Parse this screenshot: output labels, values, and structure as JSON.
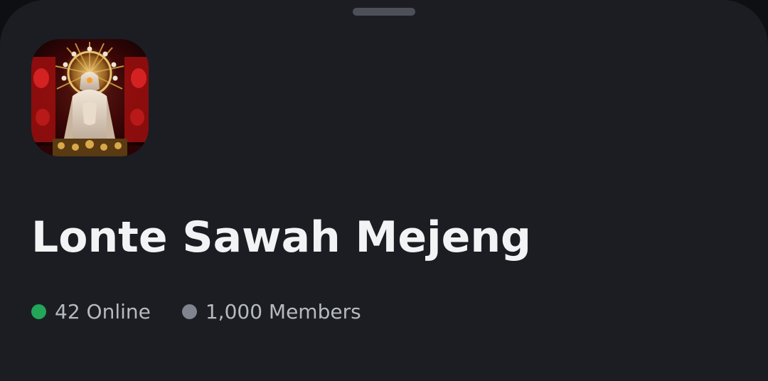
{
  "server": {
    "name": "Lonte Sawah Mejeng",
    "icon": "server-icon-image",
    "online_label": "42 Online",
    "members_label": "1,000 Members"
  },
  "colors": {
    "background": "#1c1d22",
    "online_dot": "#23a55a",
    "members_dot": "#80848e",
    "title_text": "#f2f3f5",
    "stat_text": "#b5bac1",
    "drag_handle": "#4e5058"
  }
}
